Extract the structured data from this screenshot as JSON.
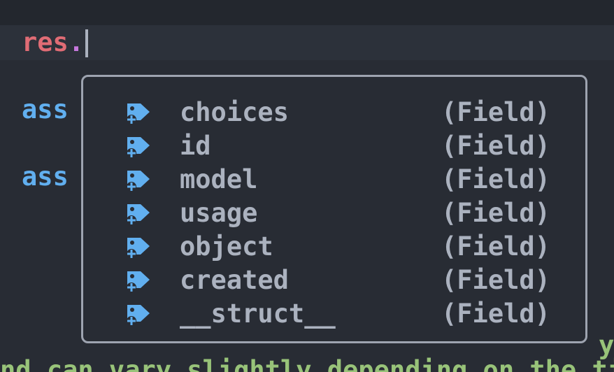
{
  "editor": {
    "line1": {
      "var": "res",
      "punct": "."
    },
    "line3": {
      "text": "ass"
    },
    "line5": {
      "text": "ass"
    },
    "right_fragment": "y",
    "bottom_fragment": "nd can vary slightly depending on the tim"
  },
  "completion": {
    "items": [
      {
        "label": "choices",
        "kind": "(Field)",
        "icon": "field-tag-icon"
      },
      {
        "label": "id",
        "kind": "(Field)",
        "icon": "field-tag-icon"
      },
      {
        "label": "model",
        "kind": "(Field)",
        "icon": "field-tag-icon"
      },
      {
        "label": "usage",
        "kind": "(Field)",
        "icon": "field-tag-icon"
      },
      {
        "label": "object",
        "kind": "(Field)",
        "icon": "field-tag-icon"
      },
      {
        "label": "created",
        "kind": "(Field)",
        "icon": "field-tag-icon"
      },
      {
        "label": "__struct__",
        "kind": "(Field)",
        "icon": "field-tag-icon"
      }
    ]
  },
  "colors": {
    "background": "#282c34",
    "icon": "#61afef",
    "text": "#abb2bf",
    "variable": "#e06c75",
    "keyword": "#61afef",
    "string": "#98c379"
  }
}
